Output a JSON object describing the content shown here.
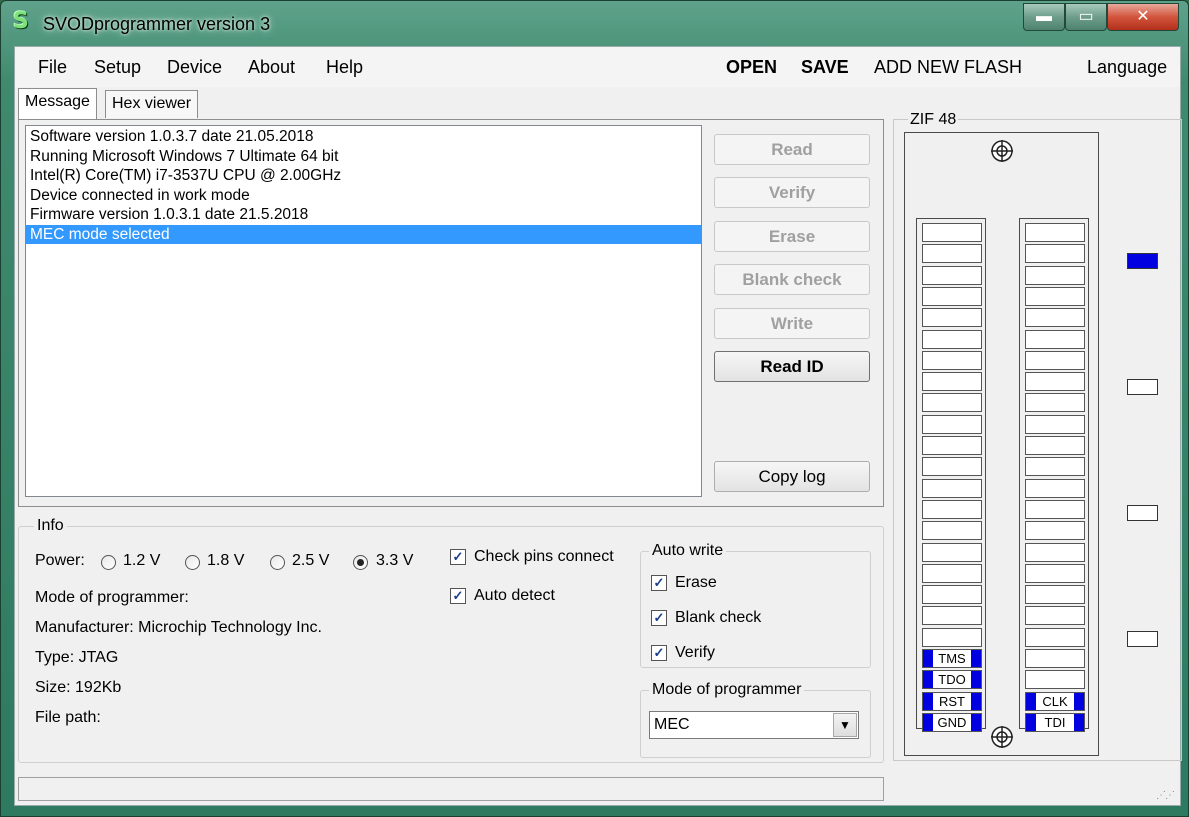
{
  "window": {
    "title": "SVODprogrammer version 3",
    "app_icon_letter": "S",
    "min_glyph": "▬",
    "max_glyph": "▭",
    "close_glyph": "✕"
  },
  "menu": {
    "file": "File",
    "setup": "Setup",
    "device": "Device",
    "about": "About",
    "help": "Help",
    "open": "OPEN",
    "save": "SAVE",
    "add_new_flash": "ADD NEW FLASH",
    "language": "Language"
  },
  "tabs": [
    "Message",
    "Hex viewer"
  ],
  "log": [
    "Software version 1.0.3.7 date 21.05.2018",
    "Running Microsoft Windows 7 Ultimate  64 bit",
    "Intel(R) Core(TM) i7-3537U CPU @ 2.00GHz",
    "Device connected in work mode",
    "Firmware version 1.0.3.1 date 21.5.2018",
    "MEC mode selected"
  ],
  "actions": {
    "read": "Read",
    "verify": "Verify",
    "erase": "Erase",
    "blank_check": "Blank check",
    "write": "Write",
    "read_id": "Read ID",
    "copy_log": "Copy log"
  },
  "zif": {
    "title": "ZIF 48",
    "left_labels": [
      "TMS",
      "TDO",
      "RST",
      "GND"
    ],
    "right_labels": [
      "CLK",
      "TDI"
    ]
  },
  "info": {
    "title": "Info",
    "power_label": "Power:",
    "voltages": [
      "1.2 V",
      "1.8 V",
      "2.5 V",
      "3.3 V"
    ],
    "selected_voltage": "3.3 V",
    "mode_of_programmer": "Mode of programmer:",
    "manufacturer": "Manufacturer: Microchip Technology Inc.",
    "type": "Type: JTAG",
    "size": "Size: 192Kb",
    "file_path": "File path:",
    "check_pins_connect": "Check pins connect",
    "auto_detect": "Auto detect",
    "check_mark": "✓"
  },
  "auto_write": {
    "title": "Auto write",
    "erase": "Erase",
    "blank_check": "Blank check",
    "verify": "Verify"
  },
  "mode_group": {
    "title": "Mode of programmer",
    "selected": "MEC",
    "arrow": "▼"
  },
  "colors": {
    "selection": "#3399ff",
    "pin_active": "#0000e0"
  }
}
